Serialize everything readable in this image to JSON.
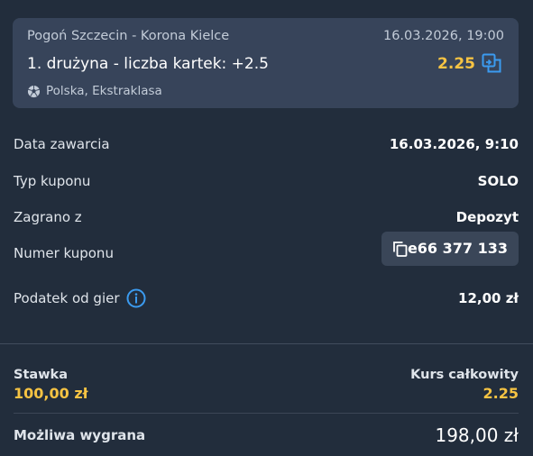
{
  "event": {
    "teams": "Pogoń Szczecin - Korona Kielce",
    "date": "16.03.2026, 19:00",
    "market": "1. drużyna - liczba kartek: +2.5",
    "odds": "2.25",
    "league": "Polska, Ekstraklasa"
  },
  "details": {
    "date_label": "Data zawarcia",
    "date_value": "16.03.2026, 9:10",
    "type_label": "Typ kuponu",
    "type_value": "SOLO",
    "played_label": "Zagrano z",
    "played_value": "Depozyt",
    "coupon_label": "Numer kuponu",
    "coupon_value": "e66 377 133",
    "tax_label": "Podatek od gier",
    "tax_value": "12,00 zł"
  },
  "summary": {
    "stake_label": "Stawka",
    "stake_value": "100,00 zł",
    "total_label": "Kurs całkowity",
    "total_value": "2.25",
    "win_label": "Możliwa wygrana",
    "win_value": "198,00 zł"
  },
  "colors": {
    "background": "#222d3c",
    "card": "#37445a",
    "accent_yellow": "#f6c343",
    "accent_blue": "#3b9bf0"
  },
  "icons": {
    "swap": "swap-icon",
    "ball": "football-icon",
    "copy": "copy-icon",
    "info": "info-icon"
  }
}
